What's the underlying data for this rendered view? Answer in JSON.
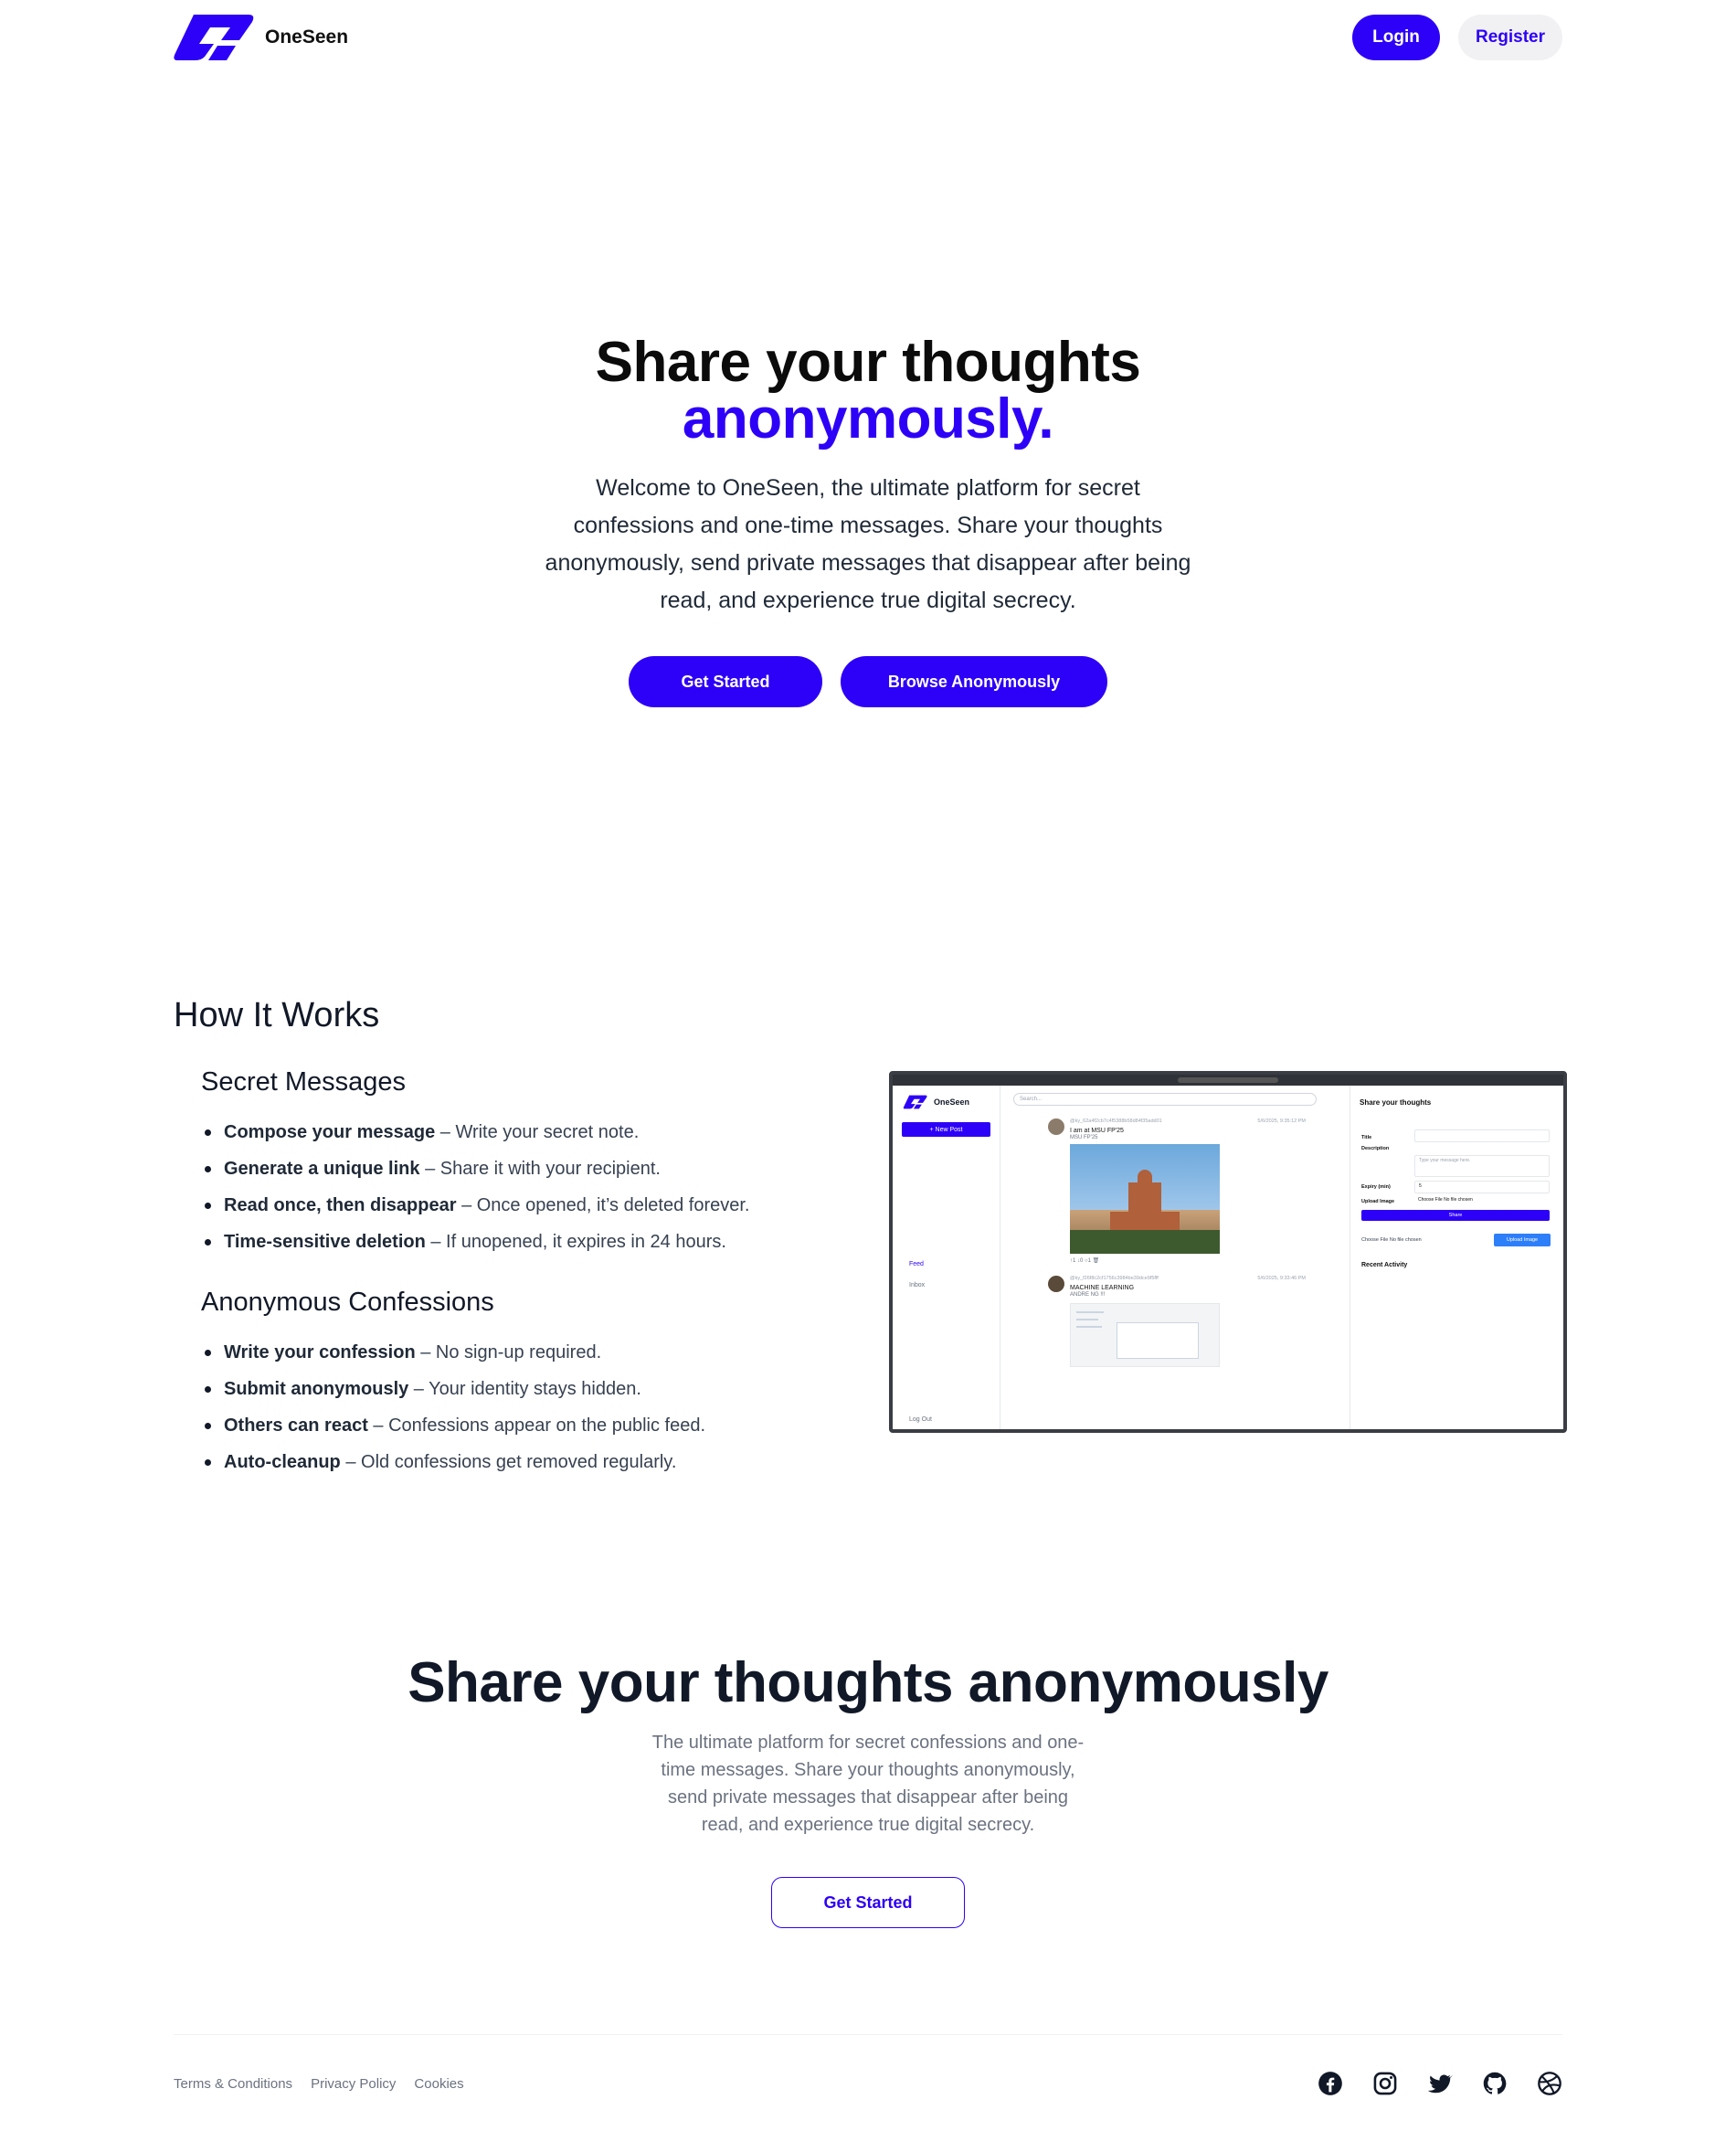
{
  "nav": {
    "brand": "OneSeen",
    "login": "Login",
    "register": "Register"
  },
  "hero": {
    "title_line1": "Share your thoughts",
    "title_line2": "anonymously.",
    "description": "Welcome to OneSeen, the ultimate platform for secret confessions and one-time messages. Share your thoughts anonymously, send private messages that disappear after being read, and experience true digital secrecy.",
    "get_started": "Get Started",
    "browse": "Browse Anonymously"
  },
  "how": {
    "title": "How It Works",
    "secret": {
      "title": "Secret Messages",
      "items": [
        {
          "bold": "Compose your message",
          "text": " – Write your secret note."
        },
        {
          "bold": "Generate a unique link",
          "text": " – Share it with your recipient."
        },
        {
          "bold": "Read once, then disappear",
          "text": " – Once opened, it’s deleted forever."
        },
        {
          "bold": "Time-sensitive deletion",
          "text": " – If unopened, it expires in 24 hours."
        }
      ]
    },
    "confessions": {
      "title": "Anonymous Confessions",
      "items": [
        {
          "bold": "Write your confession",
          "text": " – No sign-up required."
        },
        {
          "bold": "Submit anonymously",
          "text": " – Your identity stays hidden."
        },
        {
          "bold": "Others can react",
          "text": " – Confessions appear on the public feed."
        },
        {
          "bold": "Auto-cleanup",
          "text": " – Old confessions get removed regularly."
        }
      ]
    }
  },
  "mock": {
    "brand": "OneSeen",
    "new_post": "+ New Post",
    "feed": "Feed",
    "inbox": "Inbox",
    "logout": "Log Out",
    "search": "Search...",
    "post1": {
      "user": "@ky_62a4f2cb7c4f5388b58d84f35add01",
      "date": "5/6/2025, 9:35:12 PM",
      "title": "I am at MSU FP'25",
      "sub": "MSU FP'25",
      "actions": "↑1   ↓0   ○1   🗑"
    },
    "post2": {
      "user": "@ky_f26f8c2cf1756c3984be39dce9f5fff",
      "date": "5/6/2025, 9:33:46 PM",
      "title": "MACHINE LEARNING",
      "sub": "ANDRE NG !!!"
    },
    "panel_title": "Share your thoughts",
    "title_label": "Title",
    "desc_label": "Description",
    "desc_placeholder": "Type your message here.",
    "expiry_label": "Expiry (min)",
    "expiry_value": "5",
    "upload_label": "Upload Image",
    "choose_file": "Choose File No file chosen",
    "share": "Share",
    "upload_btn": "Upload Image",
    "recent": "Recent Activity"
  },
  "cta": {
    "title": "Share your thoughts anonymously",
    "description": "The ultimate platform for secret confessions and one-time messages. Share your thoughts anonymously, send private messages that disappear after being read, and experience true digital secrecy.",
    "button": "Get Started"
  },
  "footer": {
    "links": [
      "Terms & Conditions",
      "Privacy Policy",
      "Cookies"
    ],
    "socials": [
      "facebook-icon",
      "instagram-icon",
      "twitter-icon",
      "github-icon",
      "dribbble-icon"
    ]
  },
  "colors": {
    "accent": "#2d00f7",
    "text": "#111827",
    "muted": "#6b7280"
  }
}
